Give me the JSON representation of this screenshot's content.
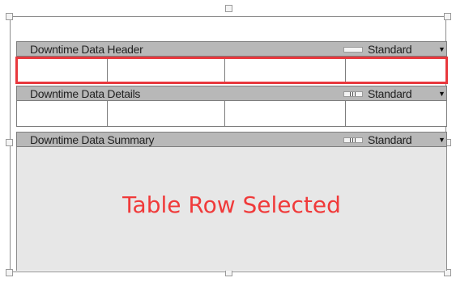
{
  "sections": {
    "header": {
      "label": "Downtime Data Header",
      "style": "Standard"
    },
    "details": {
      "label": "Downtime Data Details",
      "style": "Standard"
    },
    "summary": {
      "label": "Downtime Data Summary",
      "style": "Standard"
    }
  },
  "status_message": "Table Row Selected",
  "colors": {
    "selection": "#e8383d",
    "message": "#f03a3a",
    "bar": "#b8b8b8",
    "summary_background": "#e7e7e7"
  },
  "icons": {
    "dropdown": "chevron-down-icon",
    "column_marker": "column-marker-icon",
    "resize_handle": "resize-handle-icon"
  }
}
